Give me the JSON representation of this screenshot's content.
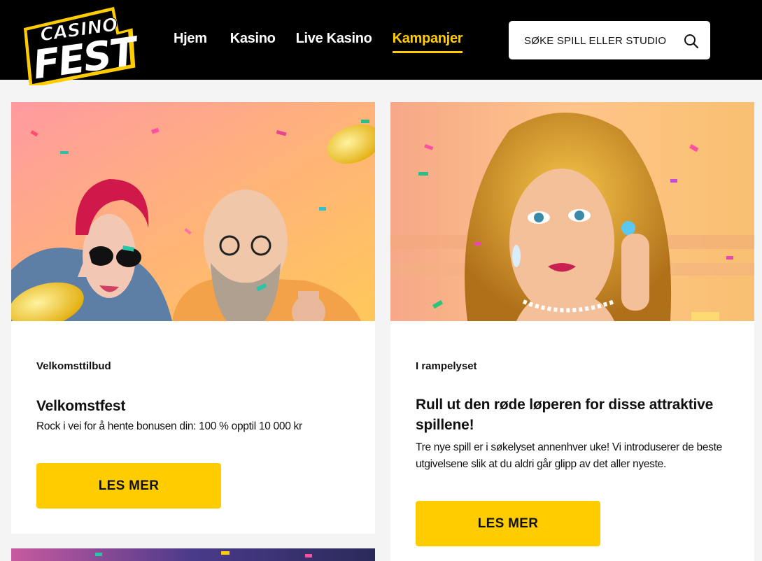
{
  "header": {
    "logo_top": "CASINO",
    "logo_bottom": "FEST",
    "nav": [
      {
        "label": "Hjem",
        "active": false
      },
      {
        "label": "Kasino",
        "active": false
      },
      {
        "label": "Live Kasino",
        "active": false
      },
      {
        "label": "Kampanjer",
        "active": true
      }
    ],
    "search": {
      "placeholder": "SØKE SPILL ELLER STUDIO"
    }
  },
  "promotions": [
    {
      "category": "Velkomsttilbud",
      "title": "Velkomstfest",
      "description": "Rock i vei for å hente bonusen din: 100 % opptil 10 000 kr",
      "button": "LES MER"
    },
    {
      "category": "I rampelyset",
      "title": "Rull ut den røde løperen for disse attraktive spillene!",
      "description": "Tre nye spill er i søkelyset annenhver uke! Vi introduserer de beste utgivelsene slik at du aldri går glipp av det aller nyeste.",
      "button": "LES MER"
    }
  ],
  "colors": {
    "accent": "#ffcc00",
    "header_bg": "#000000",
    "page_bg": "#f4f4f4"
  }
}
